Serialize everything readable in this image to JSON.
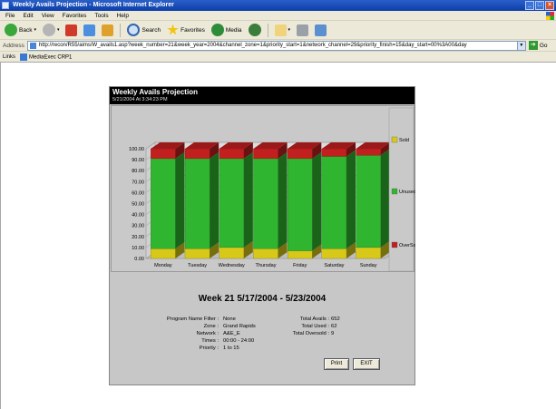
{
  "window": {
    "title": "Weekly Avails Projection - Microsoft Internet Explorer",
    "controls": [
      "_",
      "□",
      "×"
    ]
  },
  "menu": [
    "File",
    "Edit",
    "View",
    "Favorites",
    "Tools",
    "Help"
  ],
  "toolbar": {
    "back": "Back",
    "search": "Search",
    "favorites": "Favorites",
    "media": "Media"
  },
  "address": {
    "label": "Address",
    "url": "http://recon/R55/aims/W_avails1.asp?week_number=21&week_year=2004&channel_zone=1&priority_start=1&network_channel=29&priority_finish=15&day_start=00%3A00&day",
    "go": "Go"
  },
  "links": {
    "label": "Links",
    "items": [
      "MediaExec CRP1"
    ]
  },
  "report": {
    "title": "Weekly Avails Projection",
    "timestamp": "5/21/2004 At 3:34:23 PM",
    "week_heading": "Week 21   5/17/2004 - 5/23/2004",
    "details_left": [
      {
        "label": "Program Name Filter :",
        "value": "None"
      },
      {
        "label": "Zone :",
        "value": "Grand Rapids"
      },
      {
        "label": "Network :",
        "value": "A&E_E"
      },
      {
        "label": "Times :",
        "value": "00:00 - 24:00"
      },
      {
        "label": "Priority :",
        "value": "1 to 15"
      }
    ],
    "details_right": [
      {
        "label": "Total Avails :",
        "value": "652"
      },
      {
        "label": "Total Used :",
        "value": "62"
      },
      {
        "label": "Total Oversold :",
        "value": "9"
      }
    ],
    "buttons": {
      "print": "Print",
      "exit": "EXIT"
    }
  },
  "chart_data": {
    "type": "bar",
    "stacked": true,
    "style": "3d",
    "categories": [
      "Monday",
      "Tuesday",
      "Wednesday",
      "Thursday",
      "Friday",
      "Saturday",
      "Sunday"
    ],
    "series": [
      {
        "name": "Sold",
        "color": "#d8c81a",
        "values": [
          9,
          9,
          10,
          9,
          7,
          9,
          10
        ]
      },
      {
        "name": "Unused",
        "color": "#2fb52f",
        "values": [
          82,
          82,
          81,
          82,
          84,
          84,
          84
        ]
      },
      {
        "name": "OverSold",
        "color": "#c21f1f",
        "values": [
          9,
          9,
          9,
          9,
          9,
          7,
          6
        ]
      }
    ],
    "yticks": [
      "0.00",
      "10.00",
      "20.00",
      "30.00",
      "40.00",
      "50.00",
      "60.00",
      "70.00",
      "80.00",
      "90.00",
      "100.00"
    ],
    "ylim": [
      0,
      100
    ],
    "legend_position": "right"
  }
}
